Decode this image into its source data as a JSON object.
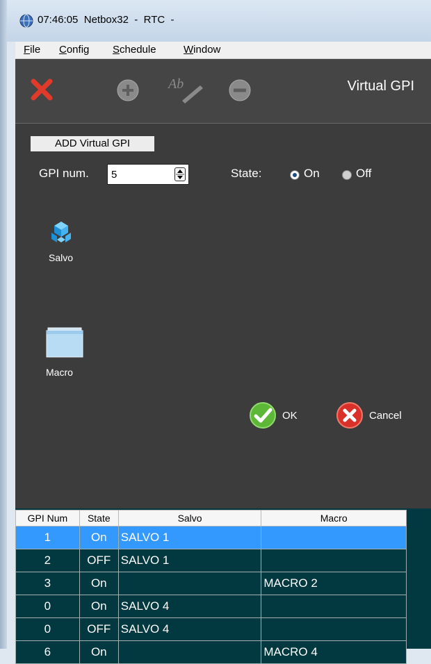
{
  "window": {
    "time": "07:46:05",
    "app": "Netbox32",
    "separator1": "-",
    "module": "RTC",
    "separator2": "-"
  },
  "menu": [
    {
      "mnemonic": "F",
      "rest": "ile"
    },
    {
      "mnemonic": "C",
      "rest": "onfig"
    },
    {
      "mnemonic": "S",
      "rest": "chedule"
    },
    {
      "mnemonic": "W",
      "rest": "indow"
    }
  ],
  "toolbar": {
    "title": "Virtual GPI",
    "icons": [
      "close-icon",
      "add-icon",
      "rename-icon",
      "remove-icon"
    ]
  },
  "form": {
    "section_label": "ADD Virtual GPI",
    "gpi_num_label": "GPI num.",
    "gpi_num_value": "5",
    "state_label": "State:",
    "state_on_label": "On",
    "state_off_label": "Off",
    "state_selected": "On",
    "salvo_label": "Salvo",
    "macro_label": "Macro",
    "ok_label": "OK",
    "cancel_label": "Cancel"
  },
  "grid": {
    "columns": [
      "GPI Num",
      "State",
      "Salvo",
      "Macro"
    ],
    "rows": [
      [
        "1",
        "On",
        "SALVO 1",
        ""
      ],
      [
        "2",
        "OFF",
        "SALVO 1",
        ""
      ],
      [
        "3",
        "On",
        "",
        "MACRO 2"
      ],
      [
        "0",
        "On",
        "SALVO 4",
        ""
      ],
      [
        "0",
        "OFF",
        "SALVO 4",
        ""
      ],
      [
        "6",
        "On",
        "",
        "MACRO 4"
      ]
    ],
    "selected_row": 0
  },
  "colors": {
    "toolbar_bg": "#454545",
    "panel_bg": "#3d3c3c",
    "grid_bg": "#02383f",
    "selection": "#3399ff",
    "close_red": "#e03a2a",
    "ok_green": "#5cb836",
    "cancel_red": "#d9302a"
  }
}
